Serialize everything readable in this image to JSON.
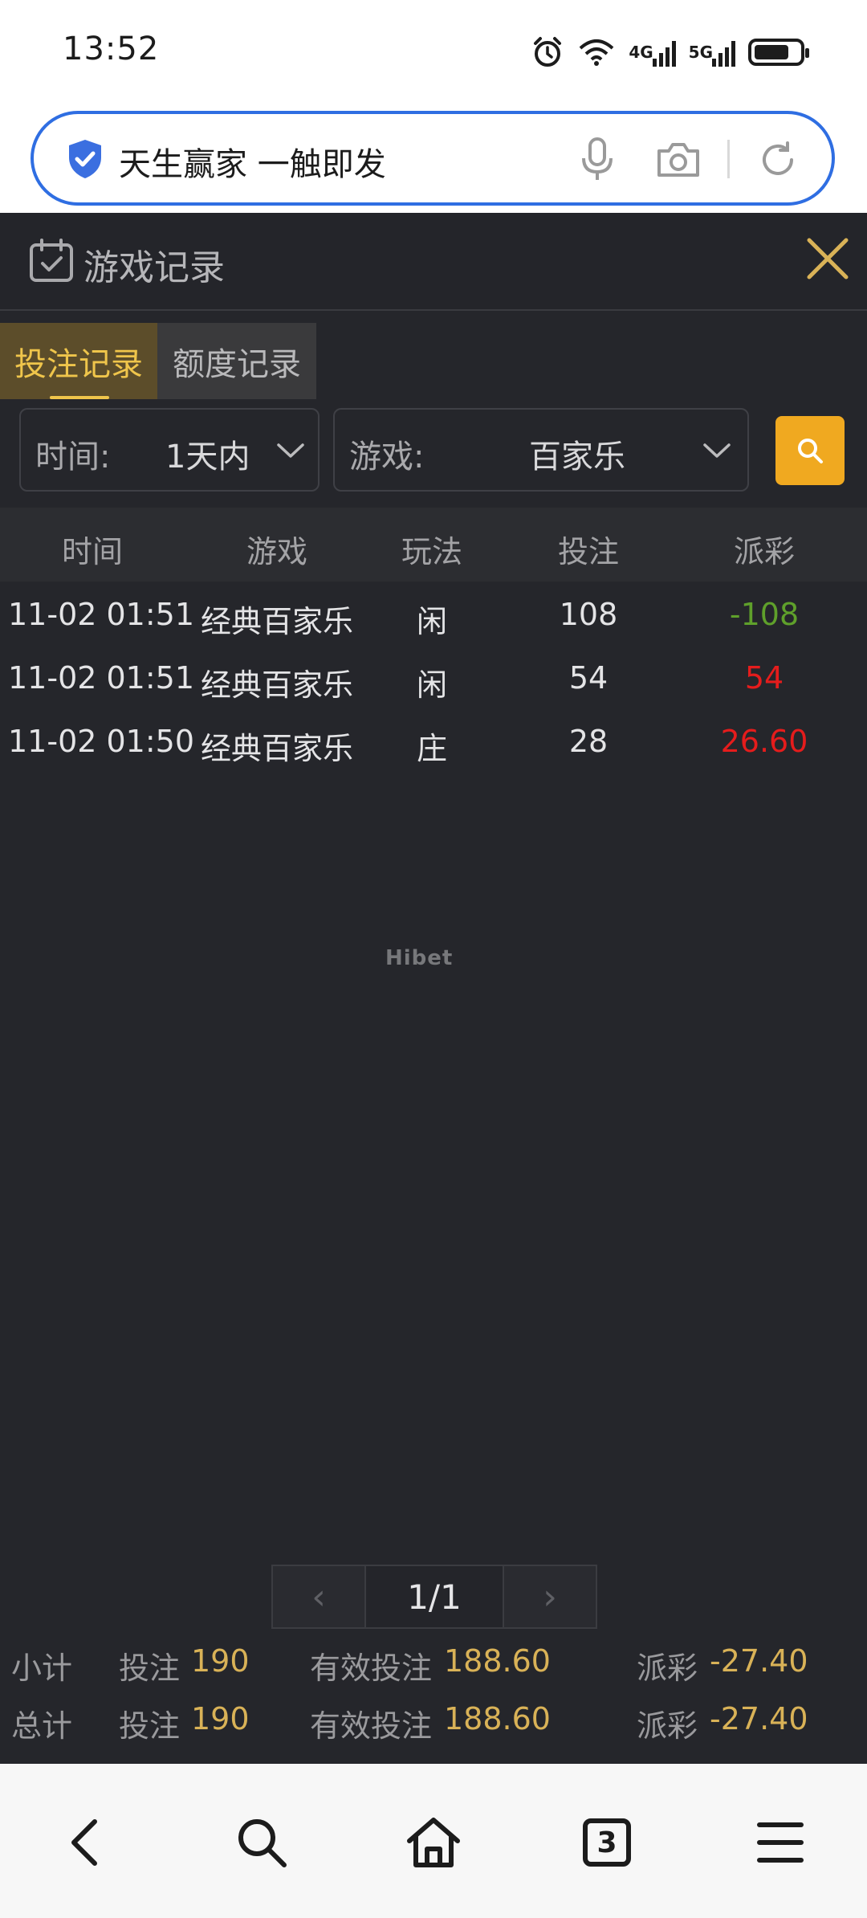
{
  "status_bar": {
    "time": "13:52",
    "net1": "4G",
    "net2": "5G"
  },
  "address_bar": {
    "url_text": "天生赢家 一触即发"
  },
  "panel": {
    "title": "游戏记录"
  },
  "tabs": [
    {
      "label": "投注记录",
      "active": true
    },
    {
      "label": "额度记录",
      "active": false
    }
  ],
  "filters": {
    "time_label": "时间:",
    "time_value": "1天内",
    "game_label": "游戏:",
    "game_value": "百家乐"
  },
  "table": {
    "headers": [
      "时间",
      "游戏",
      "玩法",
      "投注",
      "派彩"
    ],
    "rows": [
      {
        "time": "11-02 01:51",
        "game": "经典百家乐",
        "play": "闲",
        "bet": "108",
        "payout": "-108",
        "payout_color": "#5fa02b"
      },
      {
        "time": "11-02 01:51",
        "game": "经典百家乐",
        "play": "闲",
        "bet": "54",
        "payout": "54",
        "payout_color": "#e51c1c"
      },
      {
        "time": "11-02 01:50",
        "game": "经典百家乐",
        "play": "庄",
        "bet": "28",
        "payout": "26.60",
        "payout_color": "#e51c1c"
      }
    ]
  },
  "watermark": "Hibet",
  "pagination": {
    "prev": "‹",
    "page": "1/1",
    "next": "›"
  },
  "summary": {
    "subtotal": {
      "label": "小计",
      "bet_label": "投注",
      "bet": "190",
      "valid_label": "有效投注",
      "valid": "188.60",
      "payout_label": "派彩",
      "payout": "-27.40"
    },
    "total": {
      "label": "总计",
      "bet_label": "投注",
      "bet": "190",
      "valid_label": "有效投注",
      "valid": "188.60",
      "payout_label": "派彩",
      "payout": "-27.40"
    }
  },
  "bottom_nav": {
    "tab_count": "3"
  },
  "colors": {
    "accent": "#efc54b",
    "search_button": "#f0a920",
    "address_border": "#2f6ee2",
    "background": "#25262b"
  }
}
